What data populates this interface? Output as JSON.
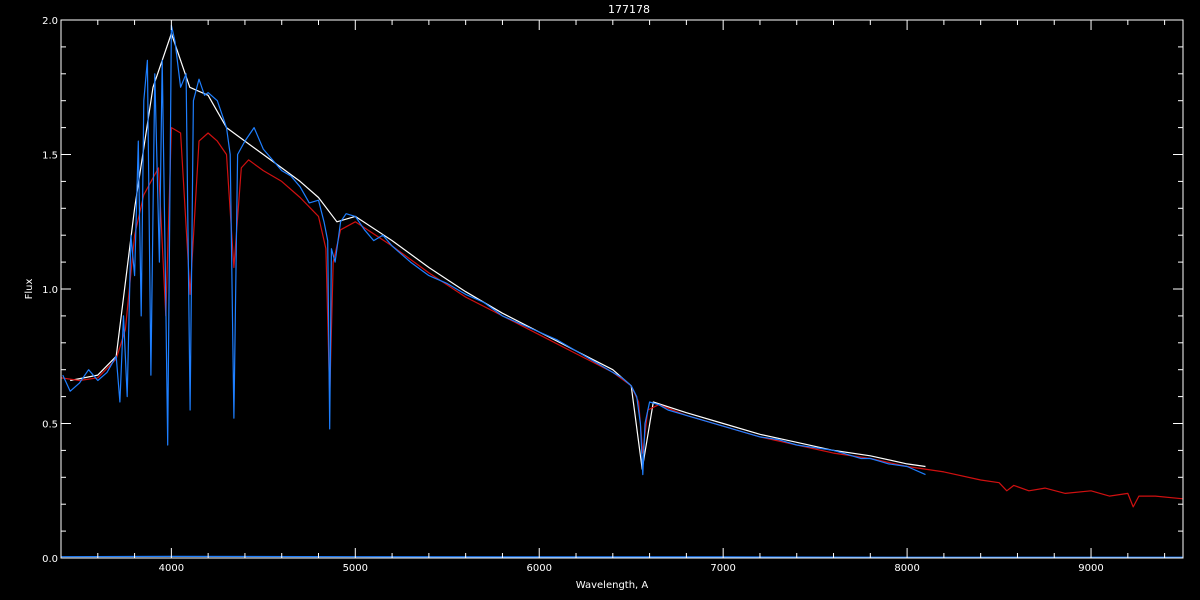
{
  "chart_data": {
    "type": "line",
    "title": "177178",
    "xlabel": "Wavelength, A",
    "ylabel": "Flux",
    "xlim": [
      3400,
      9500
    ],
    "ylim": [
      0.0,
      2.0
    ],
    "x_ticks": [
      4000,
      5000,
      6000,
      7000,
      8000,
      9000
    ],
    "x_tick_labels": [
      "4000",
      "5000",
      "6000",
      "7000",
      "8000",
      "9000"
    ],
    "y_ticks": [
      0.0,
      0.5,
      1.0,
      1.5,
      2.0
    ],
    "y_tick_labels": [
      "0.0",
      "0.5",
      "1.0",
      "1.5",
      "2.0"
    ],
    "grid": false,
    "colors": {
      "background": "#000000",
      "axes": "#ffffff",
      "model": "#d01010",
      "observed": "#1e7fff",
      "secondary": "#ffffff"
    },
    "series": [
      {
        "color": "#ffffff",
        "x": [
          3450,
          3600,
          3700,
          3800,
          3900,
          4000,
          4100,
          4200,
          4300,
          4400,
          4500,
          4600,
          4700,
          4800,
          4900,
          5000,
          5200,
          5400,
          5600,
          5800,
          6000,
          6200,
          6400,
          6500,
          6560,
          6620,
          6800,
          7000,
          7200,
          7400,
          7600,
          7800,
          8000,
          8100
        ],
        "y": [
          0.66,
          0.68,
          0.75,
          1.3,
          1.75,
          1.95,
          1.75,
          1.72,
          1.6,
          1.55,
          1.5,
          1.45,
          1.4,
          1.34,
          1.25,
          1.27,
          1.18,
          1.08,
          0.99,
          0.91,
          0.84,
          0.77,
          0.7,
          0.64,
          0.33,
          0.58,
          0.54,
          0.5,
          0.46,
          0.43,
          0.4,
          0.38,
          0.35,
          0.34
        ]
      },
      {
        "color": "#d01010",
        "x": [
          3400,
          3500,
          3600,
          3700,
          3750,
          3800,
          3850,
          3890,
          3930,
          3970,
          4000,
          4050,
          4102,
          4150,
          4200,
          4250,
          4300,
          4340,
          4380,
          4420,
          4500,
          4600,
          4700,
          4800,
          4840,
          4861,
          4880,
          4920,
          5000,
          5200,
          5400,
          5600,
          5800,
          6000,
          6200,
          6400,
          6500,
          6540,
          6563,
          6590,
          6650,
          6800,
          7000,
          7200,
          7400,
          7600,
          7800,
          8000,
          8200,
          8400,
          8500,
          8542,
          8580,
          8662,
          8750,
          8860,
          9000,
          9100,
          9200,
          9229,
          9260,
          9350,
          9500
        ],
        "y": [
          0.67,
          0.66,
          0.67,
          0.74,
          0.85,
          1.2,
          1.35,
          1.4,
          1.45,
          0.9,
          1.6,
          1.58,
          0.98,
          1.55,
          1.58,
          1.55,
          1.5,
          1.08,
          1.45,
          1.48,
          1.44,
          1.4,
          1.34,
          1.27,
          1.15,
          0.6,
          1.1,
          1.22,
          1.25,
          1.16,
          1.06,
          0.97,
          0.9,
          0.83,
          0.76,
          0.69,
          0.64,
          0.58,
          0.39,
          0.55,
          0.57,
          0.53,
          0.49,
          0.45,
          0.42,
          0.39,
          0.37,
          0.34,
          0.32,
          0.29,
          0.28,
          0.25,
          0.27,
          0.25,
          0.26,
          0.24,
          0.25,
          0.23,
          0.24,
          0.19,
          0.23,
          0.23,
          0.22
        ]
      },
      {
        "color": "#1e7fff",
        "x": [
          3410,
          3450,
          3500,
          3550,
          3600,
          3650,
          3700,
          3720,
          3740,
          3760,
          3780,
          3800,
          3820,
          3836,
          3850,
          3870,
          3889,
          3910,
          3935,
          3950,
          3970,
          3980,
          4000,
          4020,
          4050,
          4080,
          4102,
          4120,
          4150,
          4180,
          4200,
          4250,
          4300,
          4320,
          4340,
          4360,
          4400,
          4450,
          4500,
          4550,
          4600,
          4650,
          4700,
          4750,
          4800,
          4830,
          4850,
          4861,
          4870,
          4890,
          4920,
          4950,
          5000,
          5050,
          5100,
          5150,
          5200,
          5300,
          5400,
          5500,
          5600,
          5700,
          5800,
          5900,
          6000,
          6100,
          6200,
          6300,
          6400,
          6450,
          6500,
          6530,
          6550,
          6563,
          6575,
          6600,
          6650,
          6700,
          6800,
          6900,
          7000,
          7100,
          7200,
          7300,
          7400,
          7500,
          7600,
          7650,
          7700,
          7750,
          7800,
          7850,
          7900,
          8000,
          8100
        ],
        "y": [
          0.68,
          0.62,
          0.65,
          0.7,
          0.66,
          0.69,
          0.75,
          0.58,
          0.9,
          0.6,
          1.2,
          1.05,
          1.55,
          0.9,
          1.7,
          1.85,
          0.68,
          1.8,
          1.1,
          1.85,
          0.95,
          0.42,
          1.98,
          1.92,
          1.75,
          1.8,
          0.55,
          1.7,
          1.78,
          1.72,
          1.73,
          1.7,
          1.6,
          1.5,
          0.52,
          1.5,
          1.55,
          1.6,
          1.52,
          1.48,
          1.44,
          1.42,
          1.38,
          1.32,
          1.33,
          1.25,
          1.18,
          0.48,
          1.15,
          1.1,
          1.25,
          1.28,
          1.27,
          1.22,
          1.18,
          1.2,
          1.16,
          1.1,
          1.05,
          1.02,
          0.98,
          0.95,
          0.9,
          0.87,
          0.84,
          0.81,
          0.77,
          0.73,
          0.69,
          0.67,
          0.64,
          0.6,
          0.5,
          0.31,
          0.5,
          0.58,
          0.57,
          0.55,
          0.53,
          0.51,
          0.49,
          0.47,
          0.45,
          0.44,
          0.42,
          0.41,
          0.4,
          0.39,
          0.38,
          0.37,
          0.37,
          0.36,
          0.35,
          0.34,
          0.31
        ]
      },
      {
        "color": "#1e7fff",
        "x": [
          3400,
          4000,
          5000,
          6000,
          7000,
          8000,
          9000,
          9500
        ],
        "y": [
          0.005,
          0.006,
          0.005,
          0.004,
          0.004,
          0.003,
          0.003,
          0.003
        ]
      }
    ]
  }
}
